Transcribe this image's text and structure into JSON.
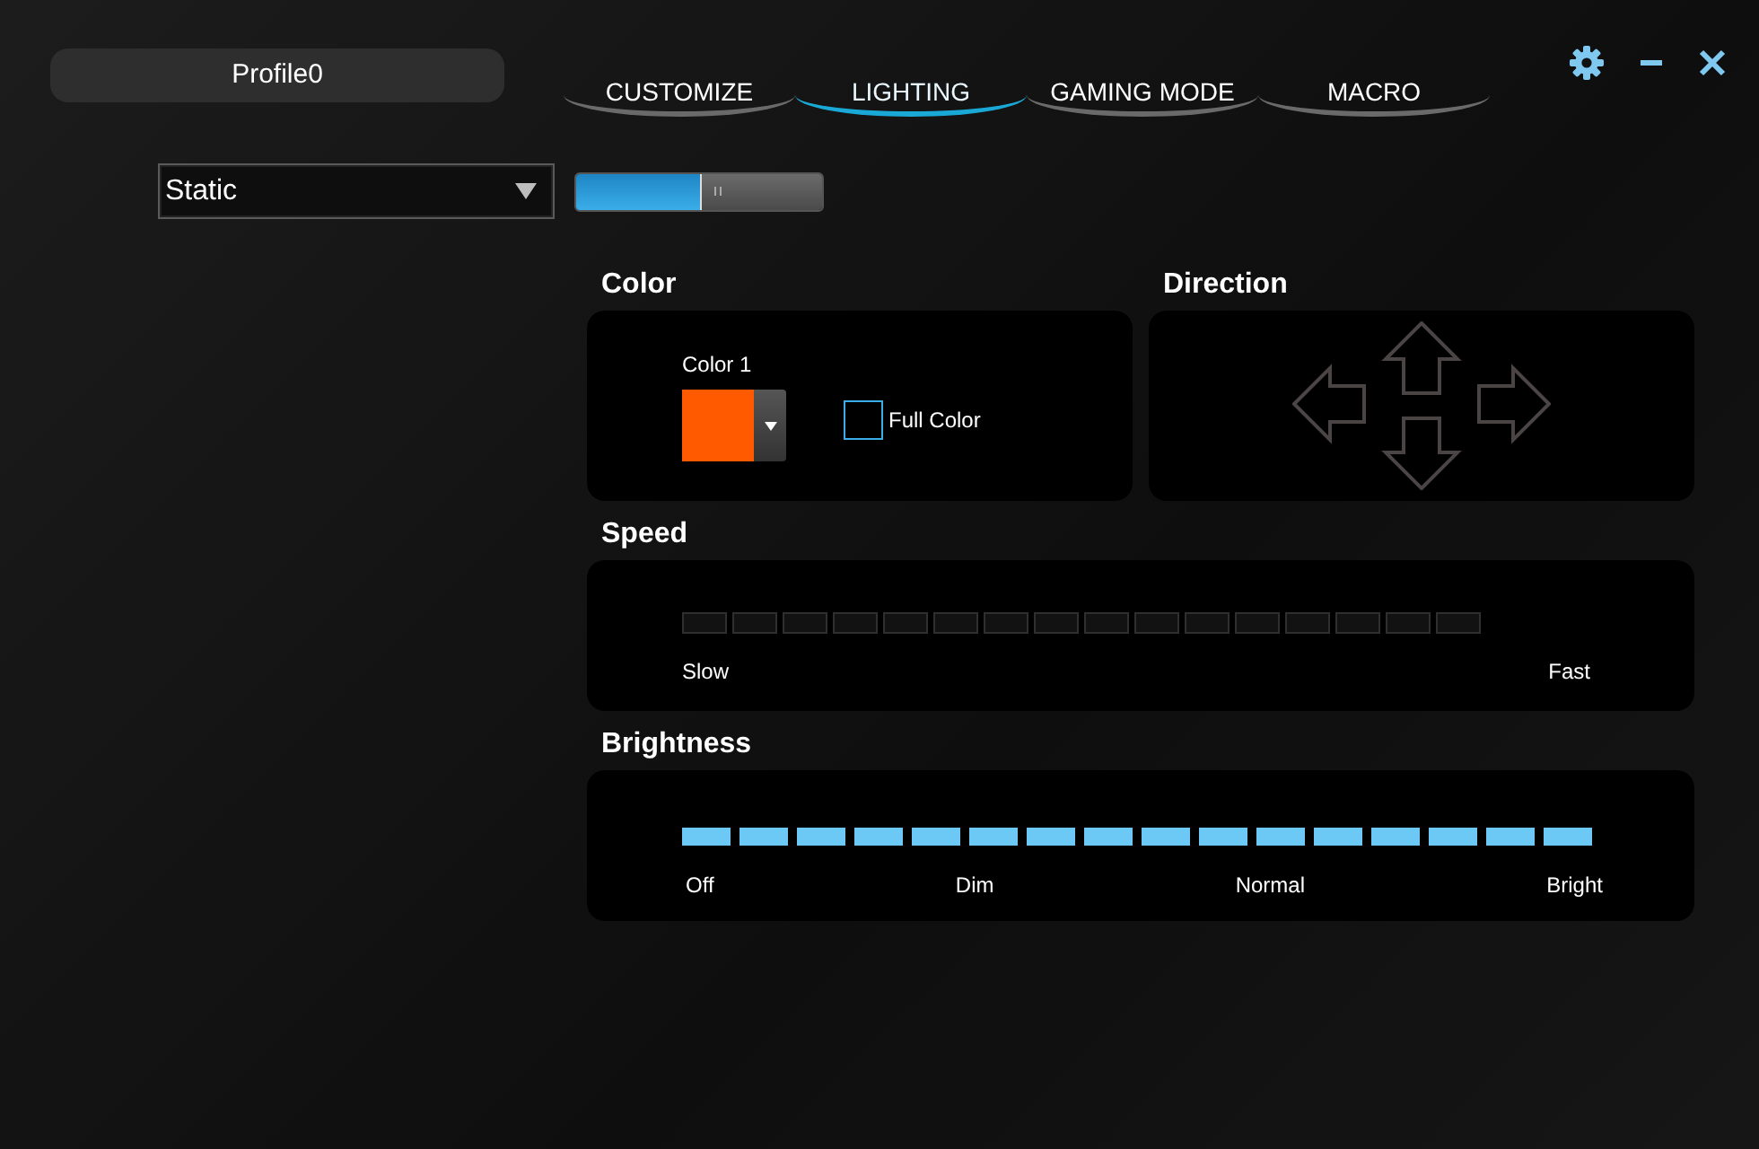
{
  "profile": {
    "name": "Profile0"
  },
  "tabs": [
    {
      "label": "CUSTOMIZE",
      "selected": false
    },
    {
      "label": "LIGHTING",
      "selected": true
    },
    {
      "label": "GAMING MODE",
      "selected": false
    },
    {
      "label": "MACRO",
      "selected": false
    }
  ],
  "effect_dropdown": {
    "value": "Static"
  },
  "lighting_toggle": {
    "on": true
  },
  "color": {
    "title": "Color",
    "color_label": "Color 1",
    "swatch": {
      "color": "#ff5a00"
    },
    "full_color": {
      "label": "Full Color",
      "checked": false
    }
  },
  "direction": {
    "title": "Direction"
  },
  "speed": {
    "title": "Speed",
    "disabled": true,
    "min_label": "Slow",
    "max_label": "Fast"
  },
  "brightness": {
    "title": "Brightness",
    "level": 1,
    "labels": [
      "Off",
      "Dim",
      "Normal",
      "Bright"
    ]
  }
}
